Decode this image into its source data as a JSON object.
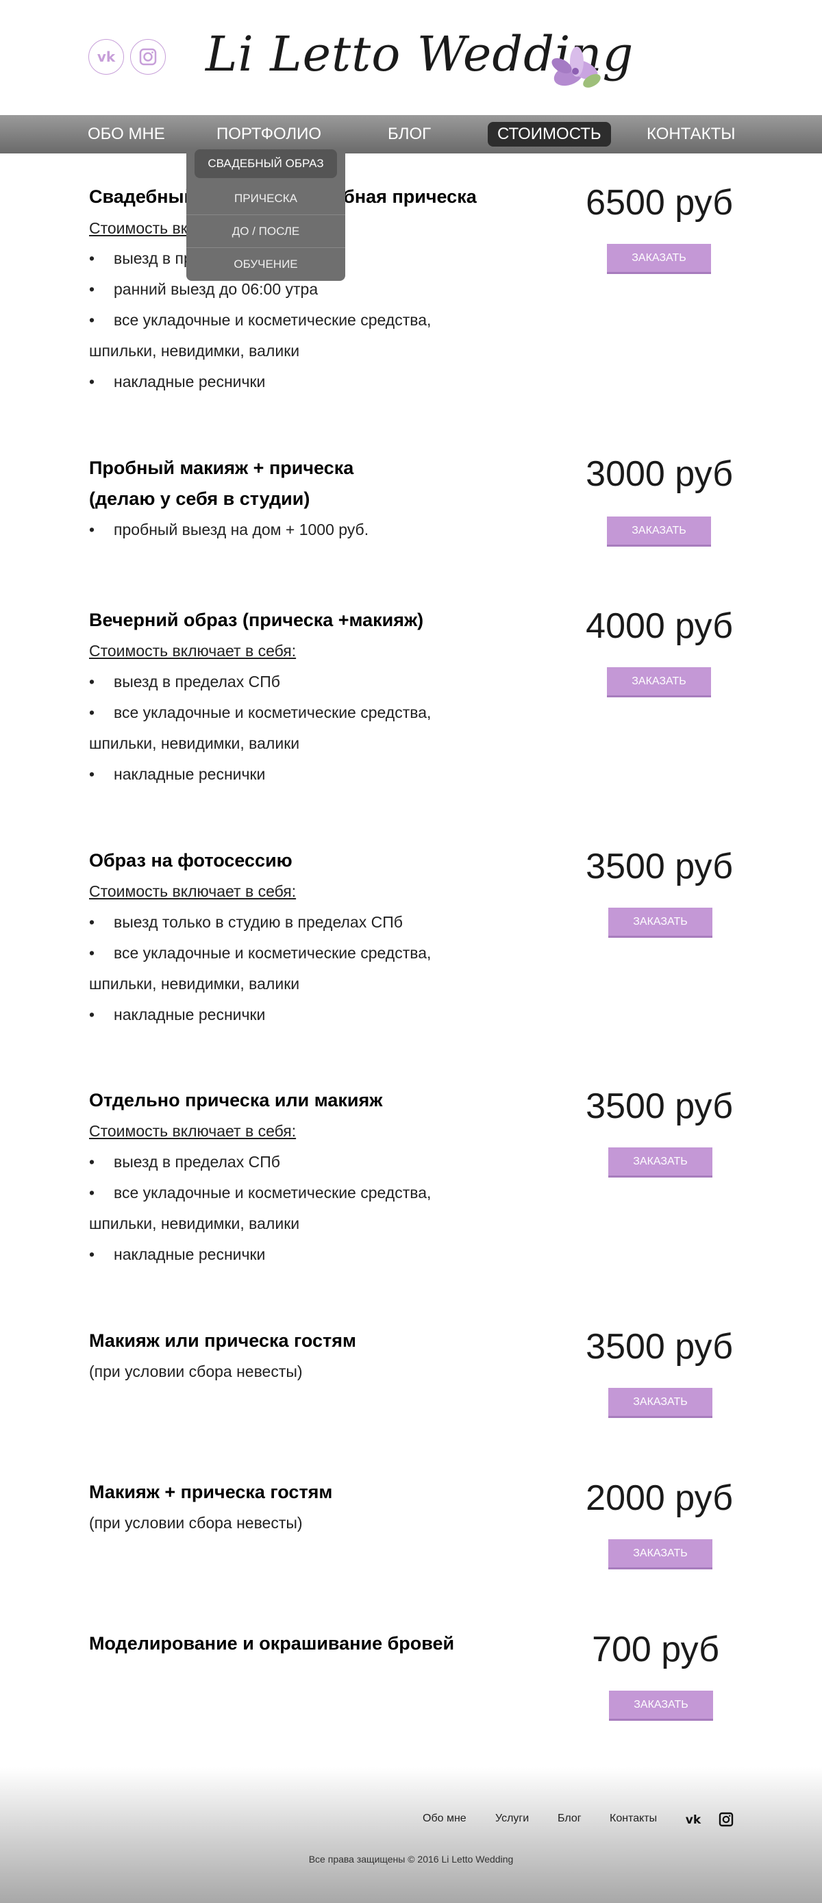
{
  "header": {
    "logo_text": "Li Letto Wedding"
  },
  "nav": {
    "items": [
      {
        "label": "ОБО МНЕ"
      },
      {
        "label": "ПОРТФОЛИО"
      },
      {
        "label": "БЛОГ"
      },
      {
        "label": "СТОИМОСТЬ"
      },
      {
        "label": "КОНТАКТЫ"
      }
    ],
    "active": "СТОИМОСТЬ"
  },
  "dropdown": {
    "items": [
      {
        "label": "СВАДЕБНЫЙ ОБРАЗ"
      },
      {
        "label": "ПРИЧЕСКА"
      },
      {
        "label": "ДО / ПОСЛЕ"
      },
      {
        "label": "ОБУЧЕНИЕ"
      }
    ]
  },
  "blocks": [
    {
      "title": "Свадебный макияж + свадебная прическа",
      "includes": "Стоимость включает в себя:",
      "bullets": [
        "выезд в пределах СПб",
        "ранний выезд до 06:00 утра",
        "все укладочные  и косметические средства,",
        "накладные реснички"
      ],
      "wrap": "шпильки, невидимки, валики",
      "price": "6500 руб",
      "button": "ЗАКАЗАТЬ"
    },
    {
      "title": "Пробный макияж + прическа",
      "title2": "(делаю у себя в студии)",
      "bullets": [
        "пробный выезд на дом + 1000 руб."
      ],
      "price": "3000 руб",
      "button": "ЗАКАЗАТЬ"
    },
    {
      "title": "Вечерний образ (прическа +макияж)",
      "includes": "Стоимость включает в себя:",
      "bullets": [
        "выезд в пределах СПб",
        "все укладочные  и косметические средства,",
        "накладные реснички"
      ],
      "wrap": "шпильки, невидимки, валики",
      "price": "4000 руб",
      "button": "ЗАКАЗАТЬ"
    },
    {
      "title": "Образ на фотосессию",
      "includes": "Стоимость включает в себя:",
      "bullets": [
        "выезд только в студию в  пределах СПб",
        "все укладочные  и косметические средства,",
        "накладные реснички"
      ],
      "wrap": "шпильки, невидимки, валики",
      "price": "3500 руб",
      "button": "ЗАКАЗАТЬ"
    },
    {
      "title": "Отдельно прическа или макияж",
      "includes": "Стоимость включает в себя:",
      "bullets": [
        "выезд в пределах СПб",
        "все укладочные  и косметические средства,",
        "накладные реснички"
      ],
      "wrap": "шпильки, невидимки, валики",
      "price": "3500 руб",
      "button": "ЗАКАЗАТЬ"
    },
    {
      "title": "Макияж или прическа гостям",
      "sub": "(при условии сбора невесты)",
      "price": "3500 руб",
      "button": "ЗАКАЗАТЬ"
    },
    {
      "title": "Макияж + прическа гостям",
      "sub": "(при условии сбора невесты)",
      "price": "2000 руб",
      "button": "ЗАКАЗАТЬ"
    },
    {
      "title": "Моделирование и окрашивание бровей",
      "price": "700 руб",
      "button": "ЗАКАЗАТЬ"
    }
  ],
  "footer": {
    "links": [
      {
        "label": "Обо мне"
      },
      {
        "label": "Услуги"
      },
      {
        "label": "Блог"
      },
      {
        "label": "Контакты"
      }
    ],
    "copyright": "Все права защищены © 2016 Li Letto Wedding"
  },
  "colors": {
    "accent": "#c498d6",
    "nav_bg": "#7d7d7d",
    "active_tab": "#2d2d2d"
  },
  "icons": [
    "vk-icon",
    "instagram-icon",
    "lily-flower-icon"
  ]
}
